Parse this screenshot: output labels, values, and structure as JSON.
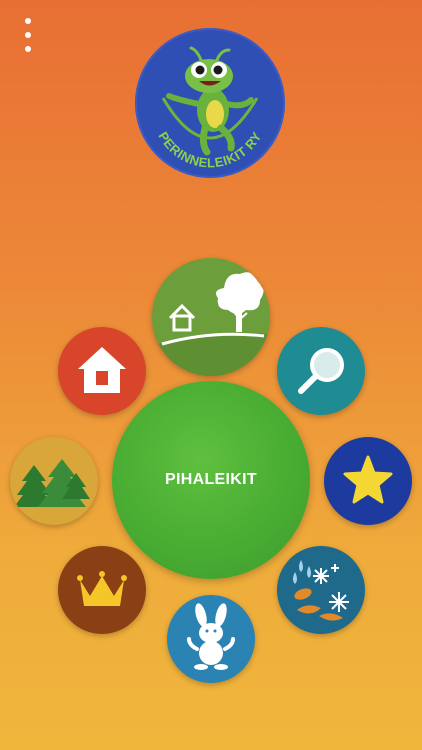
{
  "logo": {
    "text": "PERINNELEIKIT RY"
  },
  "center": {
    "label": "PIHALEIKIT"
  },
  "categories": [
    {
      "icon": "yard-house-tree-icon",
      "color": "#6c9e3c"
    },
    {
      "icon": "house-icon",
      "color": "#d9452b"
    },
    {
      "icon": "magnifier-icon",
      "color": "#1f8c93"
    },
    {
      "icon": "forest-icon",
      "color": "#d9a63a"
    },
    {
      "icon": "star-icon",
      "color": "#1d3a9e"
    },
    {
      "icon": "crown-icon",
      "color": "#8b3f14"
    },
    {
      "icon": "seasons-icon",
      "color": "#1f6a8a"
    },
    {
      "icon": "bunny-icon",
      "color": "#2b83b3"
    }
  ]
}
